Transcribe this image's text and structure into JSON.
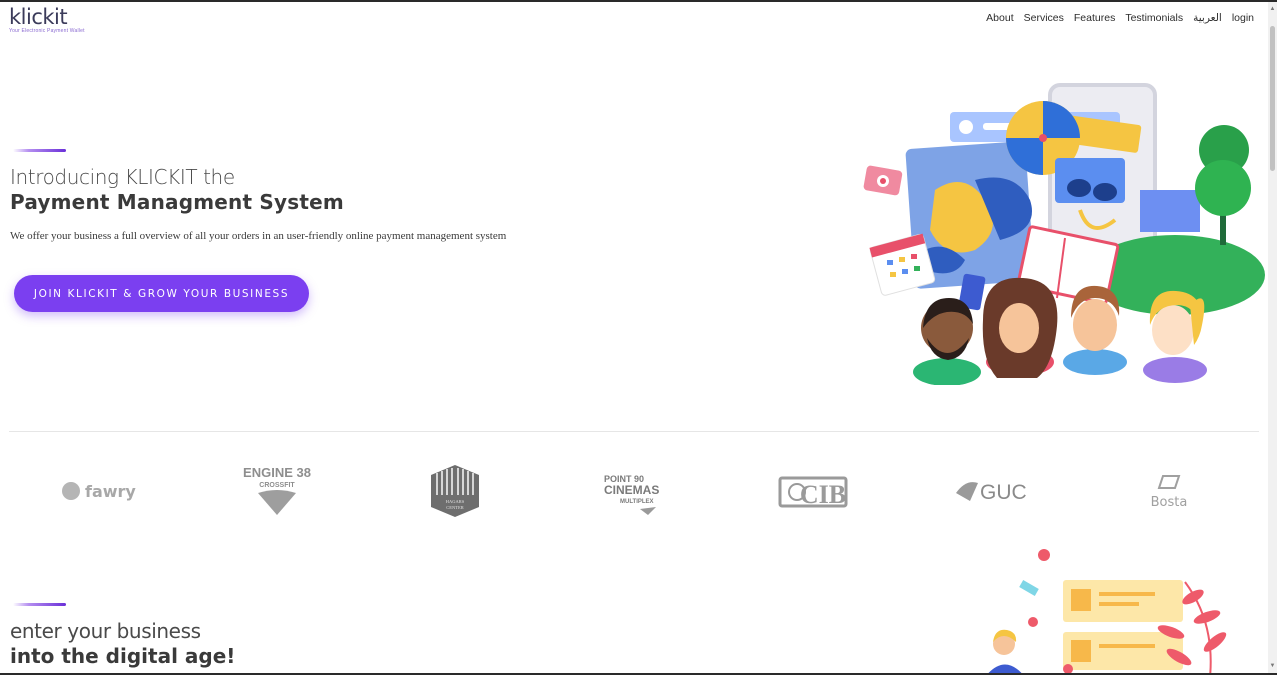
{
  "brand": {
    "logo_text": "klickit",
    "tagline": "Your Electronic Payment Wallet"
  },
  "nav": {
    "items": [
      {
        "label": "About"
      },
      {
        "label": "Services"
      },
      {
        "label": "Features"
      },
      {
        "label": "Testimonials"
      },
      {
        "label": "العربية"
      },
      {
        "label": "login"
      }
    ]
  },
  "hero": {
    "intro": "Introducing KLICKIT the",
    "title": "Payment Managment System",
    "description": "We offer your business a full overview of all your orders in an user-friendly online payment management system",
    "cta_label": "JOIN KLICKIT & GROW YOUR BUSINESS"
  },
  "partners": {
    "items": [
      {
        "name": "fawry",
        "icon": "fawry-logo"
      },
      {
        "name": "ENGINE 38",
        "sub": "CROSSFIT",
        "icon": "engine38-logo"
      },
      {
        "name": "HAGARS",
        "sub": "CENTER",
        "icon": "hagars-center-logo"
      },
      {
        "name": "POINT 90",
        "sub": "CINEMAS",
        "sub2": "MULTIPLEX",
        "icon": "point90-logo"
      },
      {
        "name": "CIB",
        "icon": "cib-logo"
      },
      {
        "name": "GUC",
        "icon": "guc-logo"
      },
      {
        "name": "Bosta",
        "icon": "bosta-logo"
      }
    ]
  },
  "section2": {
    "intro": "enter your business",
    "title": "into the digital age!"
  },
  "colors": {
    "accent": "#7b3ff0",
    "text": "#3a3a3a",
    "logo_gray": "#9a9a9a"
  }
}
